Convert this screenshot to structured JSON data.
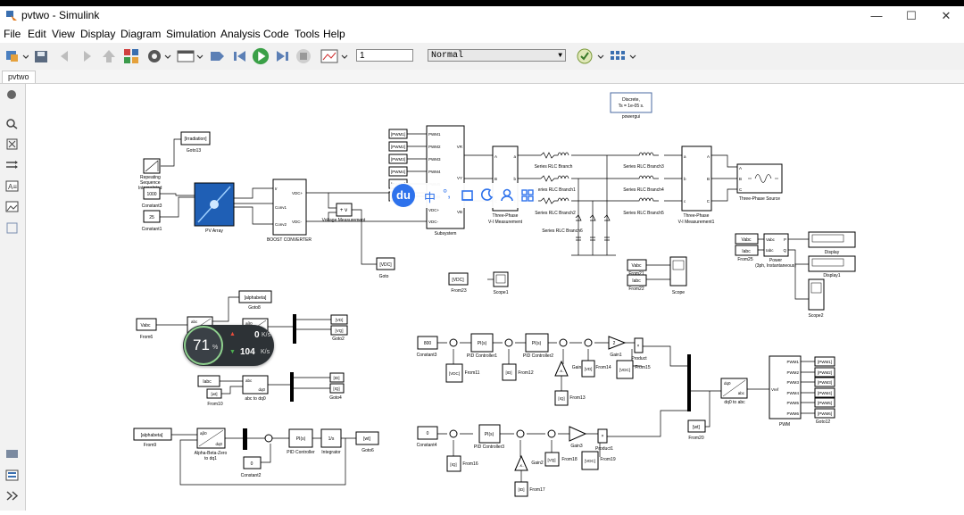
{
  "window": {
    "title": "pvtwo - Simulink",
    "buttons": [
      "minimize",
      "maximize",
      "close"
    ]
  },
  "menu": [
    "File",
    "Edit",
    "View",
    "Display",
    "Diagram",
    "Simulation",
    "Analysis",
    "Code",
    "Tools",
    "Help"
  ],
  "toolbar": {
    "stop_time": "1",
    "sim_mode": "Normal"
  },
  "tab": "pvtwo",
  "blocks": {
    "powergui": "Discrete,\nTs = 1e-05 s.",
    "powergui_label": "powergui",
    "goto_irradiation": "[Irradiation]",
    "goto13": "Goto13",
    "repeating_sequence": "Repeating\nSequence\nInterpolated",
    "const_1000": "1000",
    "constant3": "Constant3",
    "const_25": "25",
    "constant1": "Constant1",
    "pv_array": "PV Array",
    "boost_ports": [
      "Ir",
      "Conv1",
      "Conv2"
    ],
    "boost_outs": [
      "VDC+",
      "VDC-"
    ],
    "boost_converter": "BOOST CONVERTER",
    "voltage_measurement": "Voltage Measurement",
    "goto_vdc": "[VDC]",
    "goto": "Goto",
    "pwm_tags": [
      "[PWM1]",
      "[PWM2]",
      "[PWM3]",
      "[PWM4]",
      "[PWM5]",
      "[PWM6]"
    ],
    "subsystem_ports": [
      "PWM1",
      "PWM2",
      "PWM3",
      "PWM4",
      "PWM5",
      "PWM6",
      "VDC+",
      "VDC-"
    ],
    "subsystem_outs": [
      "VR",
      "VY",
      "VB"
    ],
    "subsystem": "Subsystem",
    "meas1": "Three-Phase\nV-I Measurement",
    "meas2": "Three-Phase\nV-I Measurement1",
    "rlc": [
      "Series RLC Branch",
      "Series RLC Branch1",
      "Series RLC Branch2",
      "Series RLC Branch3",
      "Series RLC Branch4",
      "Series RLC Branch5"
    ],
    "rlc_mid": "Series RLC Branch6",
    "three_phase_source": "Three-Phase Source",
    "from23_tag": "[VDC]",
    "from23": "From23",
    "scope1": "Scope1",
    "from21_tag": "Vabc",
    "from21": "From21",
    "from22_tag": "Iabc",
    "from22": "From22",
    "scope": "Scope",
    "from25_vabc": "Vabc",
    "from25_iabc": "Iabc",
    "from25": "From25",
    "power_block": "Power\n(3ph, Instantaneous)",
    "power_ports": [
      "Vabc",
      "Iabc",
      "P",
      "Q"
    ],
    "display": "Display",
    "display1": "Display1",
    "scope2": "Scope2",
    "goto_alphabeta": "[alphabeta]",
    "goto8": "Goto8",
    "from6_tag": "Vabc",
    "from6": "From6",
    "abc_block": "abc",
    "ab0": "aβ0",
    "dq0": "dq0",
    "goto_vd": "[VD]",
    "goto_vq": "[VQ]",
    "goto2": "Goto2",
    "from10_tag": "Iabc",
    "from10_wt": "[wt]",
    "from10": "From10",
    "abc_to_dq0": "abc to dq0",
    "goto_id": "[ID]",
    "goto_iq": "[IQ]",
    "goto4": "Goto4",
    "from9_tag": "[alphabeta]",
    "from9": "From9",
    "abz_to_dq": "Alpha-Beta-Zero\nto dq1",
    "const2_val": "0",
    "constant2": "Constant2",
    "pi_controller": "PID Controller",
    "pi_text": "PI(s)",
    "integrator": "Integrator",
    "integrator_text": "1/s",
    "goto_wt": "[wt]",
    "goto6": "Goto6",
    "const_800": "800",
    "constant_800": "Constant3",
    "pid1": "PID Controller1",
    "pid2": "PID Controller2",
    "pid3": "PID Controller3",
    "from11_tag": "[VDC]",
    "from11": "From11",
    "from12_tag": "[ID]",
    "from12": "From12",
    "from13_tag": "[IQ]",
    "from13": "From13",
    "from14_tag": "[VD]",
    "from14": "From14",
    "from15_tag": "[VDC]",
    "from15": "From15",
    "gain": "-K-",
    "gain_label": "Gain",
    "gain1_text": "2",
    "gain1": "Gain1",
    "product": "Product",
    "const4_val": "0",
    "constant4": "Constant4",
    "from16_tag": "[IQ]",
    "from16": "From16",
    "from17_tag": "[ID]",
    "from17": "From17",
    "from18_tag": "[VQ]",
    "from18": "From18",
    "from19_tag": "[VDC]",
    "from19": "From19",
    "gain2": "Gain2",
    "gain3": "Gain3",
    "product1": "Product1",
    "from20_tag": "[wt]",
    "from20": "From20",
    "dq0_to_abc": "dq0 to abc",
    "pwm_block": "PWM",
    "pwm_in": "Vref",
    "pwm_outs": [
      "PWM1",
      "PWM2",
      "PWM3",
      "PWM4",
      "PWM5",
      "PWM6"
    ],
    "goto12_tags": [
      "[PWM1]",
      "[PWM2]",
      "[PWM3]",
      "[PWM4]",
      "[PWM5]",
      "[PWM6]"
    ],
    "goto12": "Goto12"
  },
  "overlay_speed": {
    "percent": "71",
    "percent_unit": "%",
    "up": "0",
    "up_unit": "K/s",
    "down": "104",
    "down_unit": "K/s"
  },
  "overlay_icons": [
    "du-logo",
    "chinese-input-icon",
    "punctuation-icon",
    "keyboard-icon",
    "moon-icon",
    "user-icon",
    "grid-icon"
  ],
  "overlay_ime": "中"
}
